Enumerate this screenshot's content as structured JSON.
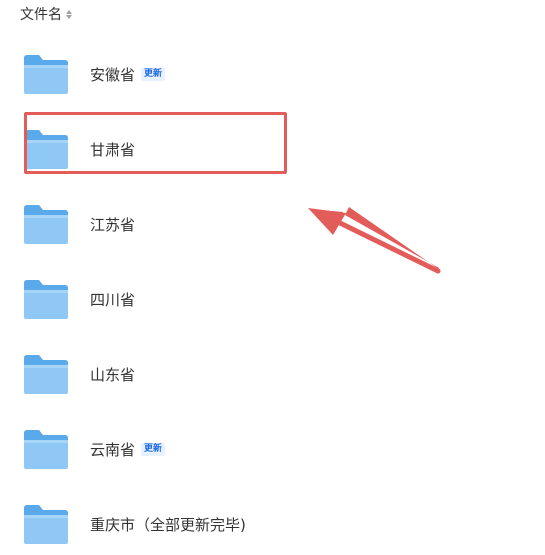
{
  "header": {
    "label": "文件名",
    "sort_icon": "sort-icon"
  },
  "badge_label": "更新",
  "folders": [
    {
      "name": "安徽省",
      "badge": true
    },
    {
      "name": "甘肃省",
      "badge": false
    },
    {
      "name": "江苏省",
      "badge": false
    },
    {
      "name": "四川省",
      "badge": false
    },
    {
      "name": "山东省",
      "badge": false
    },
    {
      "name": "云南省",
      "badge": true
    },
    {
      "name": "重庆市（全部更新完毕)",
      "badge": false
    }
  ],
  "annotation": {
    "highlighted_folder": "甘肃省",
    "color": "#e25c5a"
  },
  "colors": {
    "folder_front": "#8fc8f5",
    "folder_back": "#5aa9ea",
    "badge_text": "#1d6be0"
  }
}
